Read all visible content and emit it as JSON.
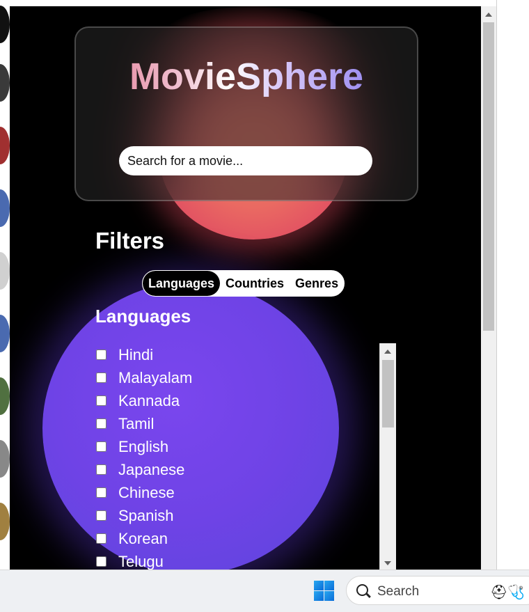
{
  "app": {
    "title": "MovieSphere",
    "search_placeholder": "Search for a movie..."
  },
  "filters": {
    "title": "Filters",
    "tabs": [
      {
        "label": "Languages",
        "active": true
      },
      {
        "label": "Countries",
        "active": false
      },
      {
        "label": "Genres",
        "active": false
      }
    ],
    "section_title": "Languages",
    "languages": [
      "Hindi",
      "Malayalam",
      "Kannada",
      "Tamil",
      "English",
      "Japanese",
      "Chinese",
      "Spanish",
      "Korean",
      "Telugu"
    ]
  },
  "taskbar": {
    "search_label": "Search"
  },
  "colors": {
    "background": "#000000",
    "accent_red": "#e85f62",
    "accent_purple": "#6f43e6"
  }
}
